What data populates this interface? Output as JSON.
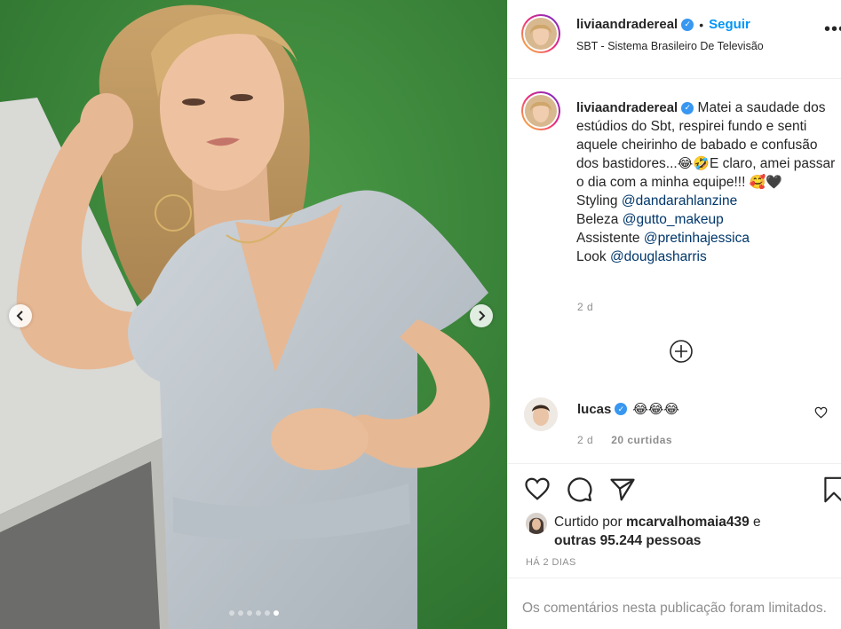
{
  "header": {
    "username": "liviaandradereal",
    "separator": "•",
    "follow_label": "Seguir",
    "location": "SBT - Sistema Brasileiro De Televisão",
    "more_label": "•••"
  },
  "caption": {
    "username": "liviaandradereal",
    "text_part1": "Matei a saudade dos estúdios do Sbt, respirei fundo e senti aquele cheirinho de babado e confusão dos bastidores...",
    "emoji1": "😂🤣",
    "text_part2": "E claro, amei passar o dia com a minha equipe!!! ",
    "emoji2": "🥰🖤",
    "styling_label": "Styling",
    "styling_mention": "@dandarahlanzine",
    "beleza_label": "Beleza",
    "beleza_mention": "@gutto_makeup",
    "assistente_label": "Assistente",
    "assistente_mention": "@pretinhajessica",
    "look_label": "Look",
    "look_mention": "@douglasharris",
    "timestamp": "2 d"
  },
  "comment": {
    "username": "lucas",
    "text": "😂😂😂",
    "timestamp": "2 d",
    "likes": "20 curtidas"
  },
  "likes": {
    "prefix": "Curtido por",
    "user": "mcarvalhomaia439",
    "conjunction": "e",
    "others": "outras 95.244 pessoas"
  },
  "date": "HÁ 2 DIAS",
  "footer": "Os comentários nesta publicação foram limitados.",
  "carousel": {
    "slides": 6,
    "active_slide": 6
  },
  "colors": {
    "accent": "#0095f6",
    "verified": "#3897f0",
    "background_green": "#3d8a3c"
  }
}
